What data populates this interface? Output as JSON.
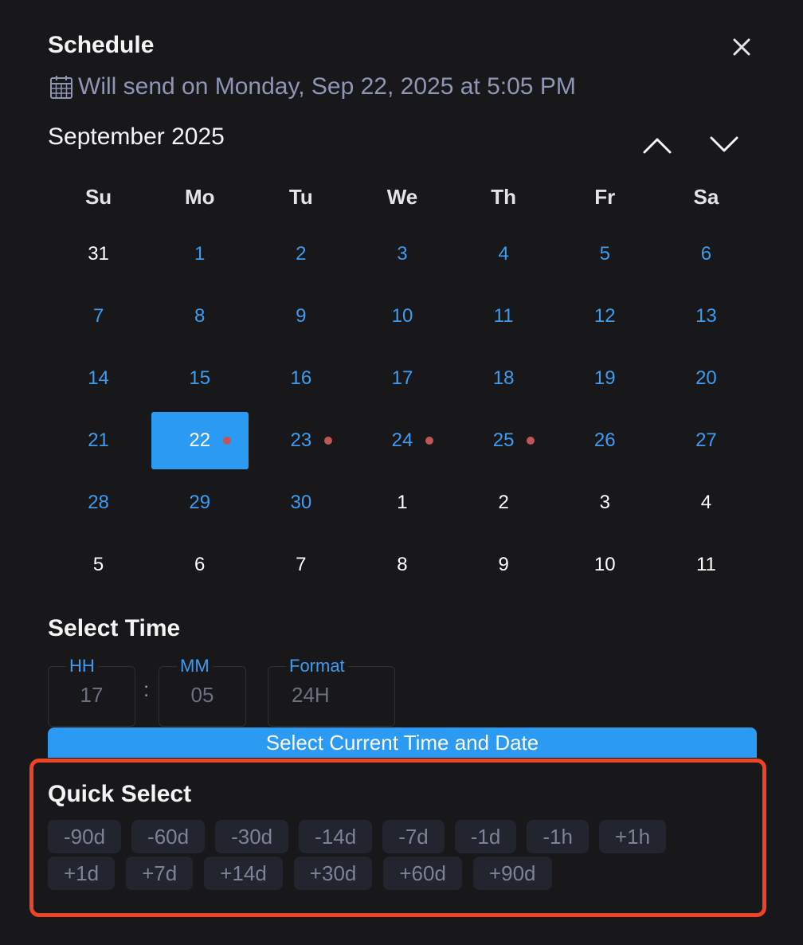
{
  "header": {
    "title": "Schedule",
    "subtitle": "Will send on Monday, Sep 22, 2025 at 5:05 PM"
  },
  "calendar": {
    "month_label": "September 2025",
    "weekdays": [
      "Su",
      "Mo",
      "Tu",
      "We",
      "Th",
      "Fr",
      "Sa"
    ],
    "weeks": [
      [
        {
          "label": "31",
          "type": "outside"
        },
        {
          "label": "1",
          "type": "current"
        },
        {
          "label": "2",
          "type": "current"
        },
        {
          "label": "3",
          "type": "current"
        },
        {
          "label": "4",
          "type": "current"
        },
        {
          "label": "5",
          "type": "current"
        },
        {
          "label": "6",
          "type": "current"
        }
      ],
      [
        {
          "label": "7",
          "type": "current"
        },
        {
          "label": "8",
          "type": "current"
        },
        {
          "label": "9",
          "type": "current"
        },
        {
          "label": "10",
          "type": "current"
        },
        {
          "label": "11",
          "type": "current"
        },
        {
          "label": "12",
          "type": "current"
        },
        {
          "label": "13",
          "type": "current"
        }
      ],
      [
        {
          "label": "14",
          "type": "current"
        },
        {
          "label": "15",
          "type": "current"
        },
        {
          "label": "16",
          "type": "current"
        },
        {
          "label": "17",
          "type": "current"
        },
        {
          "label": "18",
          "type": "current"
        },
        {
          "label": "19",
          "type": "current"
        },
        {
          "label": "20",
          "type": "current"
        }
      ],
      [
        {
          "label": "21",
          "type": "current"
        },
        {
          "label": "22",
          "type": "current",
          "selected": true,
          "marked": true
        },
        {
          "label": "23",
          "type": "current",
          "marked": true
        },
        {
          "label": "24",
          "type": "current",
          "marked": true
        },
        {
          "label": "25",
          "type": "current",
          "marked": true
        },
        {
          "label": "26",
          "type": "current"
        },
        {
          "label": "27",
          "type": "current"
        }
      ],
      [
        {
          "label": "28",
          "type": "current"
        },
        {
          "label": "29",
          "type": "current"
        },
        {
          "label": "30",
          "type": "current"
        },
        {
          "label": "1",
          "type": "outside"
        },
        {
          "label": "2",
          "type": "outside"
        },
        {
          "label": "3",
          "type": "outside"
        },
        {
          "label": "4",
          "type": "outside"
        }
      ],
      [
        {
          "label": "5",
          "type": "outside"
        },
        {
          "label": "6",
          "type": "outside"
        },
        {
          "label": "7",
          "type": "outside"
        },
        {
          "label": "8",
          "type": "outside"
        },
        {
          "label": "9",
          "type": "outside"
        },
        {
          "label": "10",
          "type": "outside"
        },
        {
          "label": "11",
          "type": "outside"
        }
      ]
    ]
  },
  "time": {
    "title": "Select Time",
    "hh_label": "HH",
    "hh_value": "17",
    "separator": ":",
    "mm_label": "MM",
    "mm_value": "05",
    "format_label": "Format",
    "format_value": "24H",
    "current_button": "Select Current Time and Date"
  },
  "quick_select": {
    "title": "Quick Select",
    "row1": [
      "-90d",
      "-60d",
      "-30d",
      "-14d",
      "-7d",
      "-1d",
      "-1h",
      "+1h"
    ],
    "row2": [
      "+1d",
      "+7d",
      "+14d",
      "+30d",
      "+60d",
      "+90d"
    ]
  },
  "colors": {
    "background": "#18181b",
    "accent": "#2b9af3",
    "current_month_day": "#3b9cf2",
    "event_dot": "#c25656",
    "muted_text": "#8e96b4",
    "chip_bg": "#22252d",
    "highlight_border": "#ef4423"
  },
  "icons": {
    "close": "close-icon",
    "calendar": "calendar-icon",
    "prev_month": "chevron-up-icon",
    "next_month": "chevron-down-icon"
  }
}
